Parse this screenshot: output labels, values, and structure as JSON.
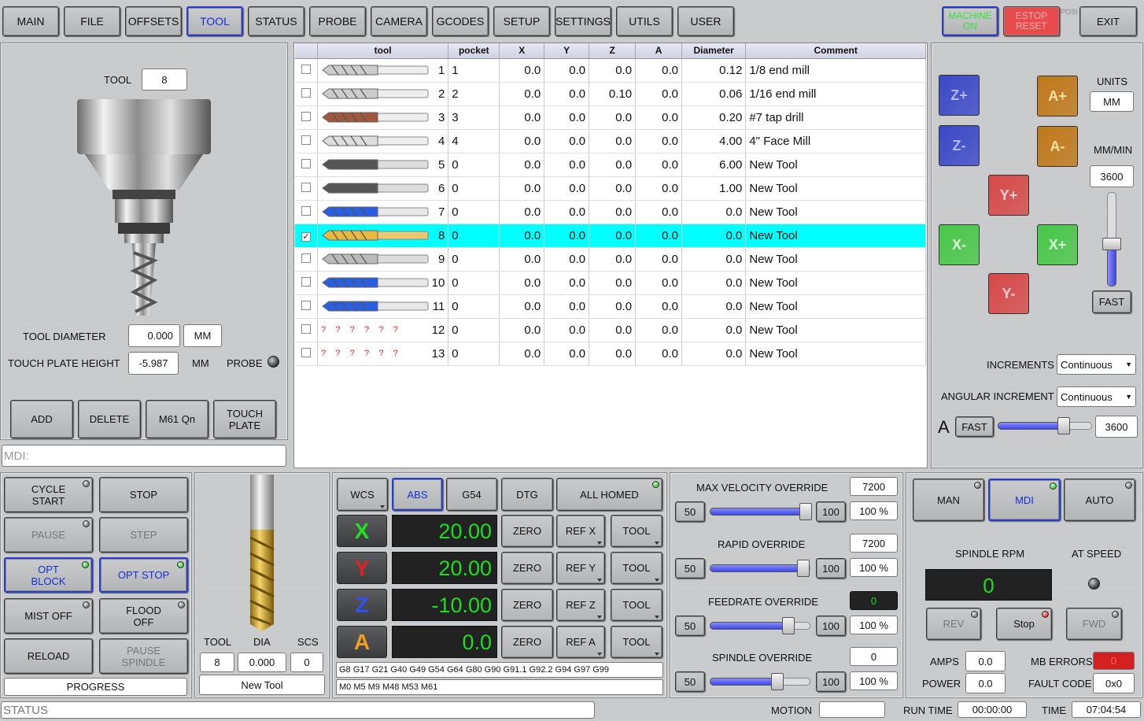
{
  "tabs": [
    "MAIN",
    "FILE",
    "OFFSETS",
    "TOOL",
    "STATUS",
    "PROBE",
    "CAMERA",
    "GCODES",
    "SETUP",
    "SETTINGS",
    "UTILS",
    "USER"
  ],
  "selected_tab": "TOOL",
  "top": {
    "machine_on": "MACHINE ON",
    "estop": "ESTOP RESET",
    "exit": "EXIT",
    "time_glyph": "POSI"
  },
  "left": {
    "tool_label": "TOOL",
    "tool_value": "8",
    "tool_diam_label": "TOOL DIAMETER",
    "tool_diam_value": "0.000",
    "tool_diam_unit": "MM",
    "touch_label": "TOUCH PLATE HEIGHT",
    "touch_value": "-5.987",
    "touch_unit": "MM",
    "probe_label": "PROBE",
    "buttons": [
      "ADD",
      "DELETE",
      "M61 Qn",
      "TOUCH PLATE"
    ],
    "mdi": "MDI:"
  },
  "table": {
    "headers": [
      "tool",
      "pocket",
      "X",
      "Y",
      "Z",
      "A",
      "Diameter",
      "Comment"
    ],
    "rows": [
      {
        "checked": false,
        "tool": "1",
        "pocket": "1",
        "x": "0.0",
        "y": "0.0",
        "z": "0.0",
        "a": "0.0",
        "d": "0.12",
        "c": "1/8 end mill",
        "img": "endmill"
      },
      {
        "checked": false,
        "tool": "2",
        "pocket": "2",
        "x": "0.0",
        "y": "0.0",
        "z": "0.10",
        "a": "0.0",
        "d": "0.06",
        "c": "1/16 end mill",
        "img": "endmill"
      },
      {
        "checked": false,
        "tool": "3",
        "pocket": "3",
        "x": "0.0",
        "y": "0.0",
        "z": "0.0",
        "a": "0.0",
        "d": "0.20",
        "c": "#7 tap drill",
        "img": "bronze"
      },
      {
        "checked": false,
        "tool": "4",
        "pocket": "4",
        "x": "0.0",
        "y": "0.0",
        "z": "0.0",
        "a": "0.0",
        "d": "4.00",
        "c": "4\" Face Mill",
        "img": "chamfer"
      },
      {
        "checked": false,
        "tool": "5",
        "pocket": "0",
        "x": "0.0",
        "y": "0.0",
        "z": "0.0",
        "a": "0.0",
        "d": "6.00",
        "c": "New Tool",
        "img": "drill"
      },
      {
        "checked": false,
        "tool": "6",
        "pocket": "0",
        "x": "0.0",
        "y": "0.0",
        "z": "0.0",
        "a": "0.0",
        "d": "1.00",
        "c": "New Tool",
        "img": "drill"
      },
      {
        "checked": false,
        "tool": "7",
        "pocket": "0",
        "x": "0.0",
        "y": "0.0",
        "z": "0.0",
        "a": "0.0",
        "d": "0.0",
        "c": "New Tool",
        "img": "blue"
      },
      {
        "checked": true,
        "tool": "8",
        "pocket": "0",
        "x": "0.0",
        "y": "0.0",
        "z": "0.0",
        "a": "0.0",
        "d": "0.0",
        "c": "New Tool",
        "img": "gold"
      },
      {
        "checked": false,
        "tool": "9",
        "pocket": "0",
        "x": "0.0",
        "y": "0.0",
        "z": "0.0",
        "a": "0.0",
        "d": "0.0",
        "c": "New Tool",
        "img": "countersink"
      },
      {
        "checked": false,
        "tool": "10",
        "pocket": "0",
        "x": "0.0",
        "y": "0.0",
        "z": "0.0",
        "a": "0.0",
        "d": "0.0",
        "c": "New Tool",
        "img": "blue"
      },
      {
        "checked": false,
        "tool": "11",
        "pocket": "0",
        "x": "0.0",
        "y": "0.0",
        "z": "0.0",
        "a": "0.0",
        "d": "0.0",
        "c": "New Tool",
        "img": "blue"
      },
      {
        "checked": false,
        "tool": "12",
        "pocket": "0",
        "x": "0.0",
        "y": "0.0",
        "z": "0.0",
        "a": "0.0",
        "d": "0.0",
        "c": "New Tool",
        "img": "unknown"
      },
      {
        "checked": false,
        "tool": "13",
        "pocket": "0",
        "x": "0.0",
        "y": "0.0",
        "z": "0.0",
        "a": "0.0",
        "d": "0.0",
        "c": "New Tool",
        "img": "unknown"
      }
    ],
    "unknown_marks": "?    ?    ?    ?    ?    ?"
  },
  "jog": {
    "units_label": "UNITS",
    "units_value": "MM",
    "rate_label": "MM/MIN",
    "rate_value": "3600",
    "fast": "FAST",
    "increments_label": "INCREMENTS",
    "increments_value": "Continuous",
    "ang_label": "ANGULAR INCREMENT",
    "ang_value": "Continuous",
    "a_label": "A",
    "a_fast": "FAST",
    "a_rate": "3600",
    "buttons": [
      "Z+",
      "Z-",
      "A+",
      "A-",
      "Y+",
      "X-",
      "X+",
      "Y-"
    ],
    "linear_slider_frac": 0.45,
    "angular_slider_frac": 0.7
  },
  "controls": {
    "cycle_start": "CYCLE START",
    "stop": "STOP",
    "pause": "PAUSE",
    "step": "STEP",
    "opt_block": "OPT BLOCK",
    "opt_stop": "OPT STOP",
    "mist": "MIST OFF",
    "flood": "FLOOD OFF",
    "reload": "RELOAD",
    "pause_spindle": "PAUSE SPINDLE",
    "progress": "PROGRESS"
  },
  "current_tool": {
    "tool_label": "TOOL",
    "dia_label": "DIA",
    "scs_label": "SCS",
    "tool": "8",
    "dia": "0.000",
    "scs": "0",
    "name": "New Tool"
  },
  "dro": {
    "wcs": "WCS",
    "abs": "ABS",
    "g54": "G54",
    "dtg": "DTG",
    "all_homed": "ALL HOMED",
    "axes": [
      {
        "n": "X",
        "v": "20.00",
        "ref": "REF X",
        "c": "#22e022"
      },
      {
        "n": "Y",
        "v": "20.00",
        "ref": "REF Y",
        "c": "#e02020"
      },
      {
        "n": "Z",
        "v": "-10.00",
        "ref": "REF Z",
        "c": "#3050f0"
      },
      {
        "n": "A",
        "v": "0.0",
        "ref": "REF A",
        "c": "#f0a020"
      }
    ],
    "zero": "ZERO",
    "tool": "TOOL",
    "gcodes": "G8 G17 G21 G40 G49 G54 G64 G80 G90 G91.1 G92.2 G94 G97 G99",
    "mcodes": "M0 M5 M9 M48 M53 M61"
  },
  "overrides": {
    "max_vel_label": "MAX VELOCITY OVERRIDE",
    "max_vel": "7200",
    "rapid_label": "RAPID OVERRIDE",
    "rapid": "7200",
    "feed_label": "FEEDRATE OVERRIDE",
    "feed": "0",
    "spindle_label": "SPINDLE OVERRIDE",
    "spindle": "0",
    "b50": "50",
    "b100": "100",
    "pct": "100 %",
    "fracs": [
      0.95,
      0.93,
      0.78,
      0.67
    ]
  },
  "spindle": {
    "man": "MAN",
    "mdi": "MDI",
    "auto": "AUTO",
    "rpm_label": "SPINDLE RPM",
    "at_speed": "AT SPEED",
    "rpm": "0",
    "rev": "REV",
    "stop": "Stop",
    "fwd": "FWD",
    "amps_label": "AMPS",
    "amps": "0.0",
    "power_label": "POWER",
    "power": "0.0",
    "mb_label": "MB ERRORS",
    "mb": "0",
    "fault_label": "FAULT CODE",
    "fault": "0x0"
  },
  "status": {
    "status": "STATUS",
    "motion_label": "MOTION",
    "motion": "",
    "runtime_label": "RUN TIME",
    "runtime": "00:00:00",
    "time_label": "TIME",
    "time": "07:04:54"
  }
}
